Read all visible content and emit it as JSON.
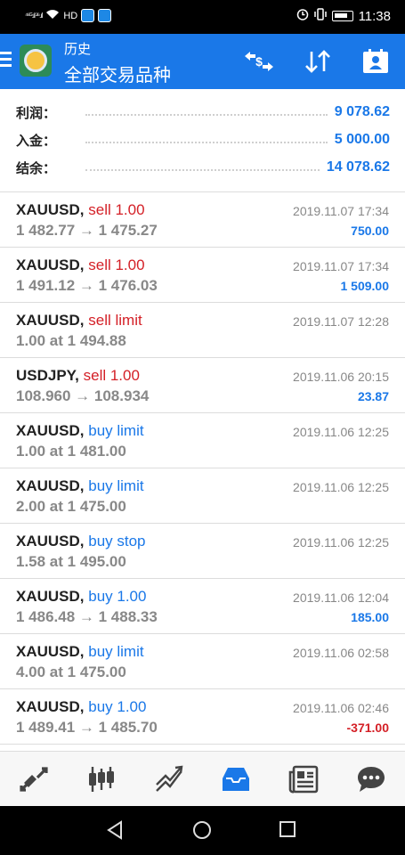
{
  "statusbar": {
    "signal_left": "⁴⁶ᴳ.ıl ²⁶.ıl",
    "carrier": "HD",
    "time": "11:38"
  },
  "header": {
    "title": "历史",
    "subtitle": "全部交易品种"
  },
  "summary": {
    "profit_label": "利润：",
    "profit_value": "9 078.62",
    "deposit_label": "入金：",
    "deposit_value": "5 000.00",
    "balance_label": "结余：",
    "balance_value": "14 078.62"
  },
  "trades": [
    {
      "symbol": "XAUUSD,",
      "type": "sell 1.00",
      "side": "sell",
      "prices": "1 482.77 → 1 475.27",
      "date": "2019.11.07 17:34",
      "profit": "750.00",
      "profit_sign": "pos"
    },
    {
      "symbol": "XAUUSD,",
      "type": "sell 1.00",
      "side": "sell",
      "prices": "1 491.12 → 1 476.03",
      "date": "2019.11.07 17:34",
      "profit": "1 509.00",
      "profit_sign": "pos"
    },
    {
      "symbol": "XAUUSD,",
      "type": "sell limit",
      "side": "sell",
      "prices": "1.00 at 1 494.88",
      "date": "2019.11.07 12:28",
      "profit": "",
      "profit_sign": "pos"
    },
    {
      "symbol": "USDJPY,",
      "type": "sell 1.00",
      "side": "sell",
      "prices": "108.960 → 108.934",
      "date": "2019.11.06 20:15",
      "profit": "23.87",
      "profit_sign": "pos"
    },
    {
      "symbol": "XAUUSD,",
      "type": "buy limit",
      "side": "buy",
      "prices": "1.00 at 1 481.00",
      "date": "2019.11.06 12:25",
      "profit": "",
      "profit_sign": "pos"
    },
    {
      "symbol": "XAUUSD,",
      "type": "buy limit",
      "side": "buy",
      "prices": "2.00 at 1 475.00",
      "date": "2019.11.06 12:25",
      "profit": "",
      "profit_sign": "pos"
    },
    {
      "symbol": "XAUUSD,",
      "type": "buy stop",
      "side": "buy",
      "prices": "1.58 at 1 495.00",
      "date": "2019.11.06 12:25",
      "profit": "",
      "profit_sign": "pos"
    },
    {
      "symbol": "XAUUSD,",
      "type": "buy 1.00",
      "side": "buy",
      "prices": "1 486.48 → 1 488.33",
      "date": "2019.11.06 12:04",
      "profit": "185.00",
      "profit_sign": "pos"
    },
    {
      "symbol": "XAUUSD,",
      "type": "buy limit",
      "side": "buy",
      "prices": "4.00 at 1 475.00",
      "date": "2019.11.06 02:58",
      "profit": "",
      "profit_sign": "pos"
    },
    {
      "symbol": "XAUUSD,",
      "type": "buy 1.00",
      "side": "buy",
      "prices": "1 489.41 → 1 485.70",
      "date": "2019.11.06 02:46",
      "profit": "-371.00",
      "profit_sign": "neg"
    }
  ],
  "colors": {
    "accent": "#1a78e8",
    "sell": "#d42027",
    "buy": "#1a78e8",
    "muted": "#888888"
  },
  "nav_icons": [
    "quotes-icon",
    "chart-icon",
    "trade-icon",
    "history-icon",
    "news-icon",
    "chat-icon"
  ]
}
